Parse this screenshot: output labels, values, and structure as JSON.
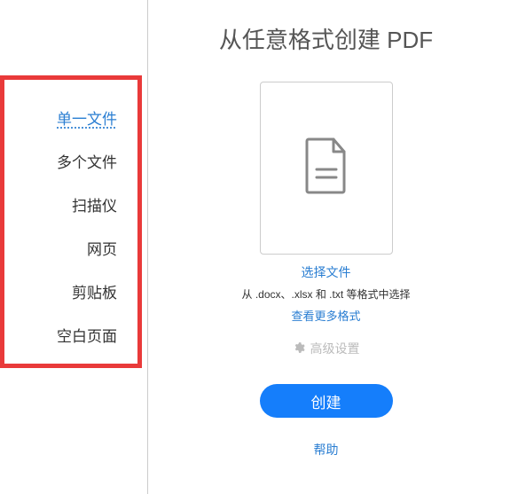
{
  "title": "从任意格式创建 PDF",
  "sidebar": {
    "items": [
      {
        "label": "单一文件",
        "selected": true
      },
      {
        "label": "多个文件",
        "selected": false
      },
      {
        "label": "扫描仪",
        "selected": false
      },
      {
        "label": "网页",
        "selected": false
      },
      {
        "label": "剪贴板",
        "selected": false
      },
      {
        "label": "空白页面",
        "selected": false
      }
    ]
  },
  "main": {
    "select_file": "选择文件",
    "hint": "从 .docx、.xlsx 和 .txt 等格式中选择",
    "more_formats": "查看更多格式",
    "advanced": "高级设置",
    "create_label": "创建",
    "help_label": "帮助"
  }
}
